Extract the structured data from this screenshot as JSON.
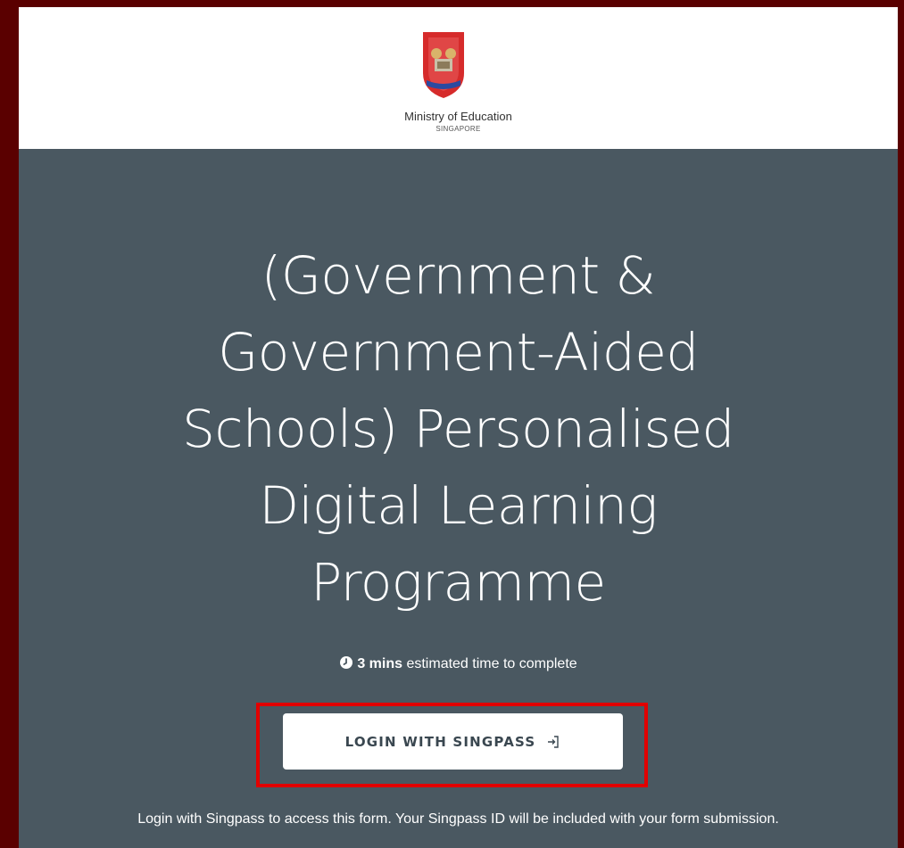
{
  "header": {
    "org_name": "Ministry of Education",
    "org_sub": "SINGAPORE"
  },
  "form": {
    "title_lines": [
      "(Government &",
      "Government-Aided",
      "Schools) Personalised",
      "Digital Learning",
      "Programme"
    ],
    "estimate_value": "3 mins",
    "estimate_text": " estimated time to complete",
    "login_label": "LOGIN WITH SINGPASS",
    "notice": "Login with Singpass to access this form. Your Singpass ID will be included with your form submission."
  },
  "icons": {
    "clock": "clock-icon",
    "login": "login-arrow-icon",
    "logo": "moe-crest-logo"
  },
  "colors": {
    "page_border": "#5a0000",
    "main_bg": "#4a5861",
    "header_bg": "#ffffff",
    "highlight": "#e10000",
    "button_text": "#3a4750"
  }
}
